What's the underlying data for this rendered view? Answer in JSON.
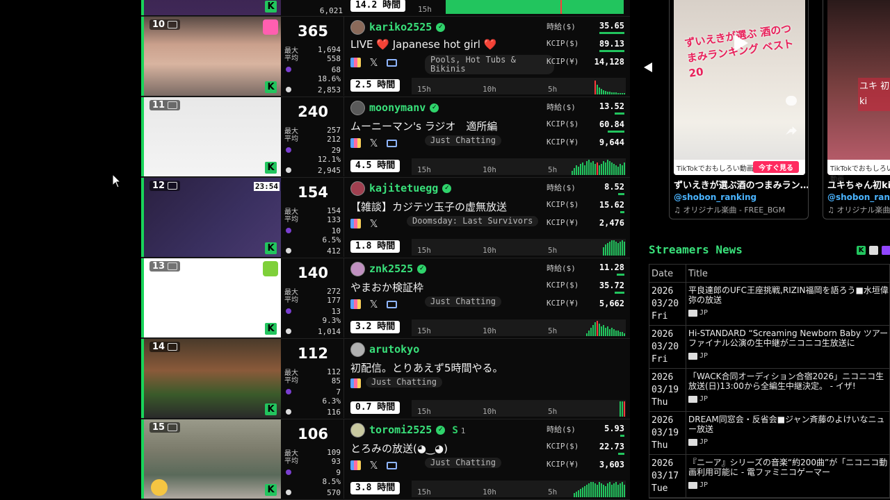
{
  "top_partial": {
    "viewers_avg": "6,021",
    "duration": "14.2 時間",
    "tick": "15h"
  },
  "labels": {
    "max": "最大",
    "avg": "平均",
    "hourly": "時給($)",
    "kcip_usd": "KCIP($)",
    "kcip_jpy": "KCIP(¥)",
    "t15": "15h",
    "t10": "10h",
    "t5": "5h",
    "x_icon": "𝕏",
    "kick": "K"
  },
  "rows": [
    {
      "rank": "10",
      "viewers": "365",
      "max": "1,694",
      "avg": "558",
      "followers": "68",
      "pct": "18.6%",
      "chat": "2,853",
      "name": "kariko2525",
      "title": "LIVE ❤️ Japanese hot girl ❤️",
      "category": "Pools, Hot Tubs & Bikinis",
      "hourly": "35.65",
      "kcip_usd": "89.13",
      "kcip_jpy": "14,128",
      "duration": "2.5 時間",
      "has_x": true,
      "has_tv": true
    },
    {
      "rank": "11",
      "viewers": "240",
      "max": "257",
      "avg": "212",
      "followers": "29",
      "pct": "12.1%",
      "chat": "2,945",
      "name": "moonymanv",
      "title": "ムーニーマン's ラジオ　適所編",
      "category": "Just Chatting",
      "hourly": "13.52",
      "kcip_usd": "60.84",
      "kcip_jpy": "9,644",
      "duration": "4.5 時間",
      "has_x": true,
      "has_tv": true
    },
    {
      "rank": "12",
      "viewers": "154",
      "max": "154",
      "avg": "133",
      "followers": "10",
      "pct": "6.5%",
      "chat": "412",
      "name": "kajitetuegg",
      "title": "【雑談】カジテツ玉子の虚無放送",
      "category": "Doomsday: Last Survivors",
      "hourly": "8.52",
      "kcip_usd": "15.62",
      "kcip_jpy": "2,476",
      "duration": "1.8 時間",
      "has_x": true,
      "has_tv": false,
      "thumb_time": "23:54"
    },
    {
      "rank": "13",
      "viewers": "140",
      "max": "272",
      "avg": "177",
      "followers": "13",
      "pct": "9.3%",
      "chat": "1,014",
      "name": "znk2525",
      "title": "やまおか検証枠",
      "category": "Just Chatting",
      "hourly": "11.28",
      "kcip_usd": "35.72",
      "kcip_jpy": "5,662",
      "duration": "3.2 時間",
      "has_x": true,
      "has_tv": true
    },
    {
      "rank": "14",
      "viewers": "112",
      "max": "112",
      "avg": "85",
      "followers": "7",
      "pct": "6.3%",
      "chat": "116",
      "name": "arutokyo",
      "title": "初配信。とりあえず5時間やる。",
      "category": "Just Chatting",
      "hourly": "",
      "kcip_usd": "",
      "kcip_jpy": "",
      "duration": "0.7 時間",
      "has_x": false,
      "has_tv": false
    },
    {
      "rank": "15",
      "viewers": "106",
      "max": "109",
      "avg": "93",
      "followers": "9",
      "pct": "8.5%",
      "chat": "570",
      "name": "toromi2525",
      "title": "とろみの放送(◕‿◕)",
      "category": "Just Chatting",
      "subs": "1",
      "hourly": "5.93",
      "kcip_usd": "22.73",
      "kcip_jpy": "3,603",
      "duration": "3.8 時間",
      "has_x": true,
      "has_tv": true
    }
  ],
  "tiktok": [
    {
      "overlay": "ずいえきが選ぶ 酒のつまみランキング ベスト20",
      "promo": "TikTokでおもしろい動画",
      "button": "今すぐ見る",
      "title": "ずいえきが選ぶ酒のつまみラン…",
      "user": "@shobon_ranking",
      "music": "♫ オリジナル楽曲 - FREE_BGM"
    },
    {
      "overlay": "ユキ 初ki",
      "promo": "TikTokでおもしろい動画",
      "title": "ユキちゃん初ki…",
      "user": "@shobon_rank",
      "music": "♫ オリジナル楽曲 - FREE"
    }
  ],
  "news": {
    "heading": "Streamers News",
    "columns": {
      "date": "Date",
      "title": "Title"
    },
    "items": [
      {
        "year": "2026",
        "md": "03/20",
        "dow": "Fri",
        "title": "平良達郎のUFC王座挑戦,RIZIN福岡を語ろう■水垣偉弥の放送",
        "lang": "JP"
      },
      {
        "year": "2026",
        "md": "03/20",
        "dow": "Fri",
        "title": "Hi-STANDARD “Screaming Newborn Baby ツアーファイナル公演の生中継がニコニコ生放送に",
        "lang": "JP"
      },
      {
        "year": "2026",
        "md": "03/19",
        "dow": "Thu",
        "title": "「WACK合同オーディション合宿2026」ニコニコ生放送(日)13:00から全編生中継決定。 - イザ!",
        "lang": "JP"
      },
      {
        "year": "2026",
        "md": "03/19",
        "dow": "Thu",
        "title": "DREAM同窓会・反省会■ジャン斉藤のよけいなニュー放送",
        "lang": "JP"
      },
      {
        "year": "2026",
        "md": "03/17",
        "dow": "Tue",
        "title": "『ニーア』シリーズの音楽“約200曲”が「ニコニコ動画利用可能に - 電ファミニコゲーマー",
        "lang": "JP"
      }
    ]
  },
  "colors": {
    "accent_green": "#39e07a",
    "kick_green": "#22c55e",
    "tiktok_button": "#ff2a5f",
    "tiktok_user": "#4ab4ff"
  }
}
